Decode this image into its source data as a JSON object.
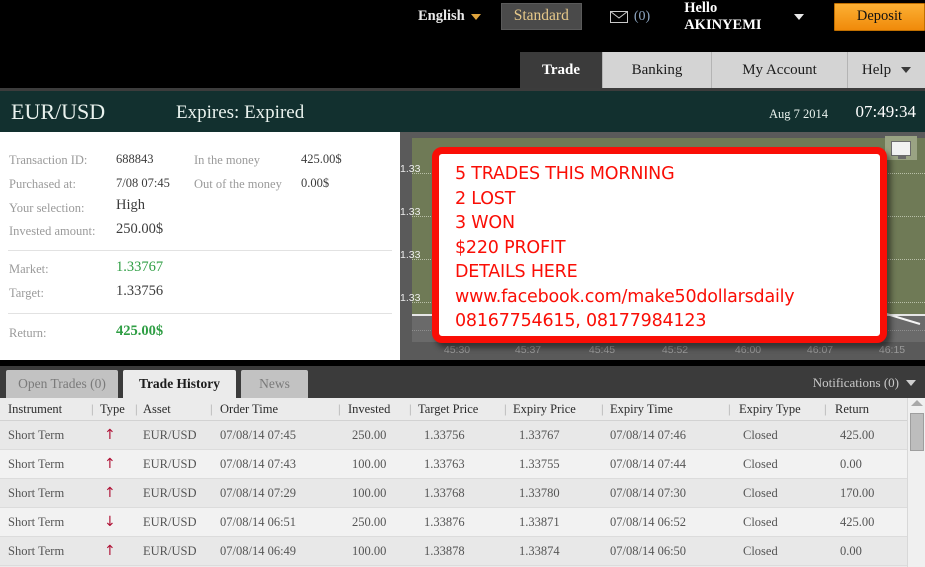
{
  "topbar": {
    "language": "English",
    "account_type": "Standard",
    "messages_count": "(0)",
    "greeting": "Hello AKINYEMI",
    "deposit_label": "Deposit"
  },
  "nav": {
    "tabs": [
      {
        "label": "Trade",
        "active": true
      },
      {
        "label": "Banking",
        "active": false
      },
      {
        "label": "My Account",
        "active": false
      },
      {
        "label": "Help",
        "active": false
      }
    ]
  },
  "asset_header": {
    "asset": "EUR/USD",
    "expires": "Expires: Expired",
    "date": "Aug 7 2014",
    "time": "07:49:34"
  },
  "details": {
    "transaction_id_label": "Transaction ID:",
    "transaction_id": "688843",
    "purchased_at_label": "Purchased at:",
    "purchased_at": "7/08 07:45",
    "selection_label": "Your selection:",
    "selection": "High",
    "invested_label": "Invested amount:",
    "invested": "250.00$",
    "in_the_money_label": "In the money",
    "in_the_money": "425.00$",
    "out_of_money_label": "Out of the money",
    "out_of_money": "0.00$",
    "market_label": "Market:",
    "market": "1.33767",
    "target_label": "Target:",
    "target": "1.33756",
    "return_label": "Return:",
    "return": "425.00$"
  },
  "chart_data": {
    "type": "line",
    "title": "",
    "xlabel": "",
    "ylabel": "",
    "y_tick_labels": [
      "1.33",
      "1.33",
      "1.33",
      "1.33"
    ],
    "x_tick_labels": [
      "45:30",
      "45:37",
      "45:45",
      "45:52",
      "46:00",
      "46:07",
      "46:15"
    ],
    "series": [
      {
        "name": "EUR/USD",
        "values": [
          1.3379,
          1.33788,
          1.33783,
          1.33776,
          1.3377,
          1.33767
        ]
      }
    ],
    "grid": true,
    "legend": "none",
    "fullscreen_icon": "monitor-icon"
  },
  "bottom_tabs": {
    "tabs": [
      {
        "label": "Open Trades (0)",
        "active": false
      },
      {
        "label": "Trade History",
        "active": true
      },
      {
        "label": "News",
        "active": false
      }
    ],
    "notifications": "Notifications (0)"
  },
  "table": {
    "columns": [
      "Instrument",
      "Type",
      "Asset",
      "Order Time",
      "Invested",
      "Target Price",
      "Expiry Price",
      "Expiry Time",
      "Expiry Type",
      "Return"
    ],
    "rows": [
      {
        "instrument": "Short Term",
        "type": "up",
        "asset": "EUR/USD",
        "order_time": "07/08/14 07:45",
        "invested": "250.00",
        "target_price": "1.33756",
        "expiry_price": "1.33767",
        "expiry_time": "07/08/14 07:46",
        "expiry_type": "Closed",
        "return": "425.00"
      },
      {
        "instrument": "Short Term",
        "type": "up",
        "asset": "EUR/USD",
        "order_time": "07/08/14 07:43",
        "invested": "100.00",
        "target_price": "1.33763",
        "expiry_price": "1.33755",
        "expiry_time": "07/08/14 07:44",
        "expiry_type": "Closed",
        "return": "0.00"
      },
      {
        "instrument": "Short Term",
        "type": "up",
        "asset": "EUR/USD",
        "order_time": "07/08/14 07:29",
        "invested": "100.00",
        "target_price": "1.33768",
        "expiry_price": "1.33780",
        "expiry_time": "07/08/14 07:30",
        "expiry_type": "Closed",
        "return": "170.00"
      },
      {
        "instrument": "Short Term",
        "type": "down",
        "asset": "EUR/USD",
        "order_time": "07/08/14 06:51",
        "invested": "250.00",
        "target_price": "1.33876",
        "expiry_price": "1.33871",
        "expiry_time": "07/08/14 06:52",
        "expiry_type": "Closed",
        "return": "425.00"
      },
      {
        "instrument": "Short Term",
        "type": "up",
        "asset": "EUR/USD",
        "order_time": "07/08/14 06:49",
        "invested": "100.00",
        "target_price": "1.33878",
        "expiry_price": "1.33874",
        "expiry_time": "07/08/14 06:50",
        "expiry_type": "Closed",
        "return": "0.00"
      }
    ]
  },
  "overlay": {
    "lines": [
      "5 TRADES THIS MORNING",
      "2 LOST",
      "3 WON",
      "$220 PROFIT",
      "DETAILS HERE",
      "www.facebook.com/make50dollarsdaily",
      "08167754615, 08177984123"
    ],
    "border_color": "#fa0e06",
    "text_color": "#fa0e06"
  }
}
